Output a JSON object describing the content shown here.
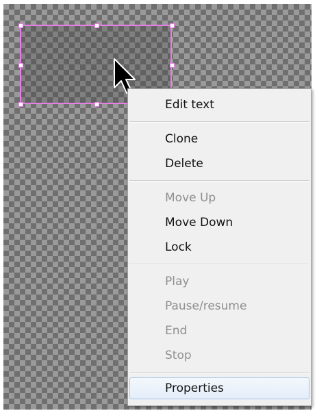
{
  "context_menu": {
    "groups": [
      [
        {
          "label": "Edit text",
          "enabled": true
        }
      ],
      [
        {
          "label": "Clone",
          "enabled": true
        },
        {
          "label": "Delete",
          "enabled": true
        }
      ],
      [
        {
          "label": "Move Up",
          "enabled": false
        },
        {
          "label": "Move Down",
          "enabled": true
        },
        {
          "label": "Lock",
          "enabled": true
        }
      ],
      [
        {
          "label": "Play",
          "enabled": false
        },
        {
          "label": "Pause/resume",
          "enabled": false
        },
        {
          "label": "End",
          "enabled": false
        },
        {
          "label": "Stop",
          "enabled": false
        }
      ],
      [
        {
          "label": "Properties",
          "enabled": true,
          "highlighted": true
        }
      ]
    ]
  },
  "colors": {
    "selection_border": "#e87ee6",
    "menu_background": "#f0f0f0",
    "disabled_text": "#8f8f8f",
    "highlight_border": "#a7c4e6"
  },
  "icons": {
    "cursor": "arrow-cursor-icon"
  }
}
